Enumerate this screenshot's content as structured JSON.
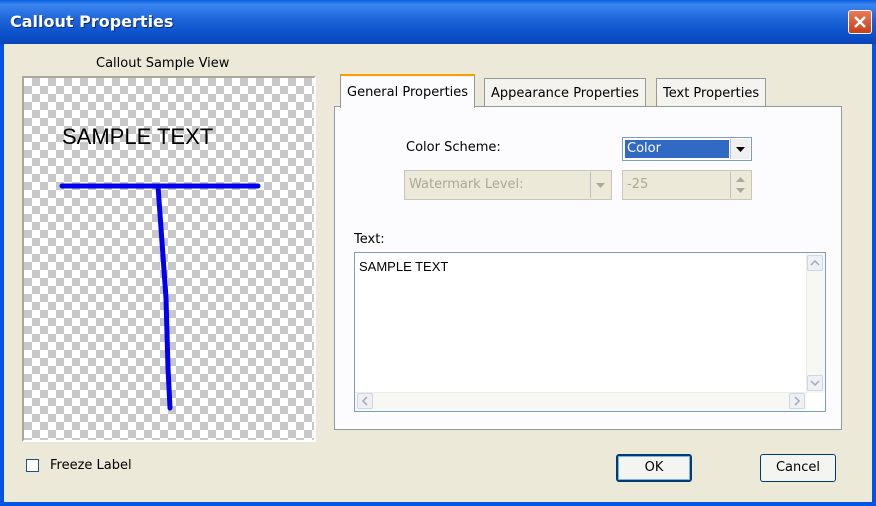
{
  "window": {
    "title": "Callout Properties"
  },
  "sample": {
    "label": "Callout Sample View",
    "text": "SAMPLE TEXT",
    "line_color": "#0000ee"
  },
  "tabs": [
    {
      "label": "General Properties",
      "active": true
    },
    {
      "label": "Appearance Properties",
      "active": false
    },
    {
      "label": "Text Properties",
      "active": false
    }
  ],
  "general": {
    "color_scheme_label": "Color Scheme:",
    "color_scheme_value": "Color",
    "watermark_level_label": "Watermark Level:",
    "watermark_value": "-25",
    "text_label": "Text:",
    "text_value": "SAMPLE TEXT"
  },
  "footer": {
    "freeze_label": "Freeze Label",
    "freeze_checked": false,
    "ok_label": "OK",
    "cancel_label": "Cancel"
  },
  "colors": {
    "title_bar": "#0a4fc8",
    "dialog_bg": "#ece9d8",
    "selection": "#316ac5",
    "close": "#c93c16"
  }
}
